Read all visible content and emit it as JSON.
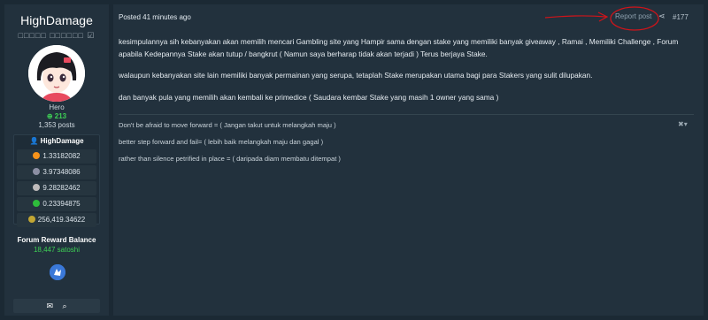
{
  "profile": {
    "username": "HighDamage",
    "title_glyphs": "□□□□□ □□□□□□ ☑",
    "rank": "Hero",
    "reputation": "213",
    "posts": "1,353 posts"
  },
  "wallet": {
    "header": "HighDamage",
    "rows": [
      {
        "value": "1.33182082",
        "icon": "bitcoin-icon",
        "color": "#f7931a"
      },
      {
        "value": "3.97348086",
        "icon": "ethereum-icon",
        "color": "#8c8fa3"
      },
      {
        "value": "9.28282462",
        "icon": "litecoin-icon",
        "color": "#bfbbbb"
      },
      {
        "value": "0.23394875",
        "icon": "bitcoin-cash-icon",
        "color": "#2ebd3b"
      },
      {
        "value": "256,419.34622",
        "icon": "dogecoin-icon",
        "color": "#c2a633"
      }
    ]
  },
  "reward": {
    "label": "Forum Reward Balance",
    "value": "18,447 satoshi"
  },
  "post": {
    "date": "Posted 41 minutes ago",
    "report": "Report post",
    "number": "#177",
    "paragraphs": [
      "kesimpulannya sih kebanyakan akan memilih mencari Gambling site yang Hampir sama dengan stake yang memiliki banyak giveaway , Ramai , Memiliki Challenge , Forum apabila Kedepannya Stake akan tutup / bangkrut ( Namun saya berharap tidak akan terjadi ) Terus berjaya Stake.",
      "walaupun kebanyakan site lain memiliki banyak permainan yang serupa, tetaplah Stake merupakan utama bagi para Stakers yang sulit dilupakan.",
      "dan banyak pula yang memilih akan kembali ke primedice ( Saudara kembar Stake yang masih 1 owner yang sama )"
    ],
    "signature": [
      "Don't be afraid to move forward = ( Jangan takut untuk melangkah maju )",
      "better step forward and fail= ( lebih baik melangkah maju dan gagal )",
      "rather than silence petrified in place = ( daripada diam membatu ditempat )"
    ]
  },
  "colors": {
    "background": "#1b2934",
    "panel": "#22313d",
    "accent_green": "#3ecf55",
    "annotation_red": "#d0141a"
  }
}
